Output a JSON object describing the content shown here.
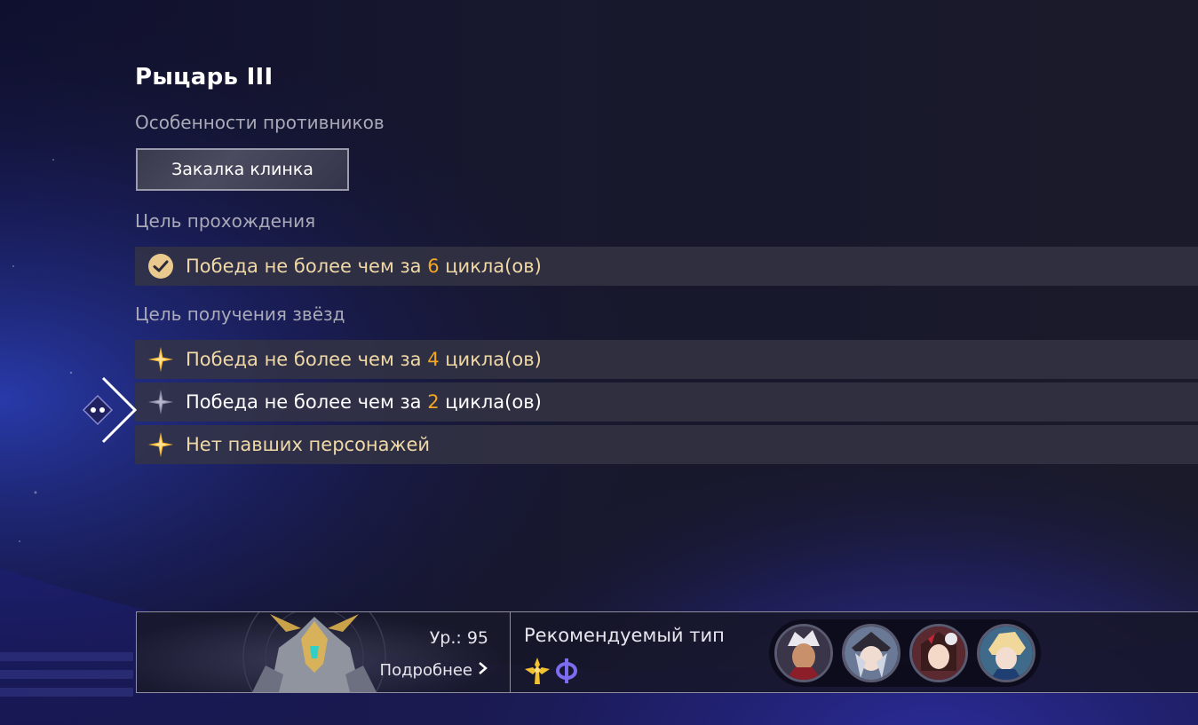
{
  "stage": {
    "title": "Рыцарь III"
  },
  "enemy_features": {
    "label": "Особенности противников",
    "tag": "Закалка клинка"
  },
  "clear_goal": {
    "label": "Цель прохождения",
    "item": {
      "prefix": "Победа не более чем за ",
      "number": "6",
      "suffix": " цикла(ов)",
      "icon": "checkmark-icon",
      "completed": true
    }
  },
  "star_goals": {
    "label": "Цель получения звёзд",
    "items": [
      {
        "prefix": "Победа не более чем за ",
        "number": "4",
        "suffix": " цикла(ов)",
        "icon": "star-icon",
        "achieved": true
      },
      {
        "prefix": "Победа не более чем за ",
        "number": "2",
        "suffix": " цикла(ов)",
        "icon": "star-icon",
        "achieved": false
      },
      {
        "text": "Нет павших персонажей",
        "icon": "star-icon",
        "achieved": true
      }
    ]
  },
  "enemy": {
    "level": "Ур.: 95",
    "details": "Подробнее"
  },
  "recommended": {
    "label": "Рекомендуемый тип",
    "types": [
      "quantum-type-icon",
      "imaginary-type-icon"
    ]
  },
  "party": {
    "avatars": [
      "party-avatar-1",
      "party-avatar-2",
      "party-avatar-3",
      "party-avatar-4"
    ]
  },
  "colors": {
    "accent_gold": "#f5a623",
    "goal_text": "#f0d9a6",
    "star_gold": "#f7b733",
    "star_inactive": "#8a8aa6",
    "quantum": "#7b6cf0"
  }
}
